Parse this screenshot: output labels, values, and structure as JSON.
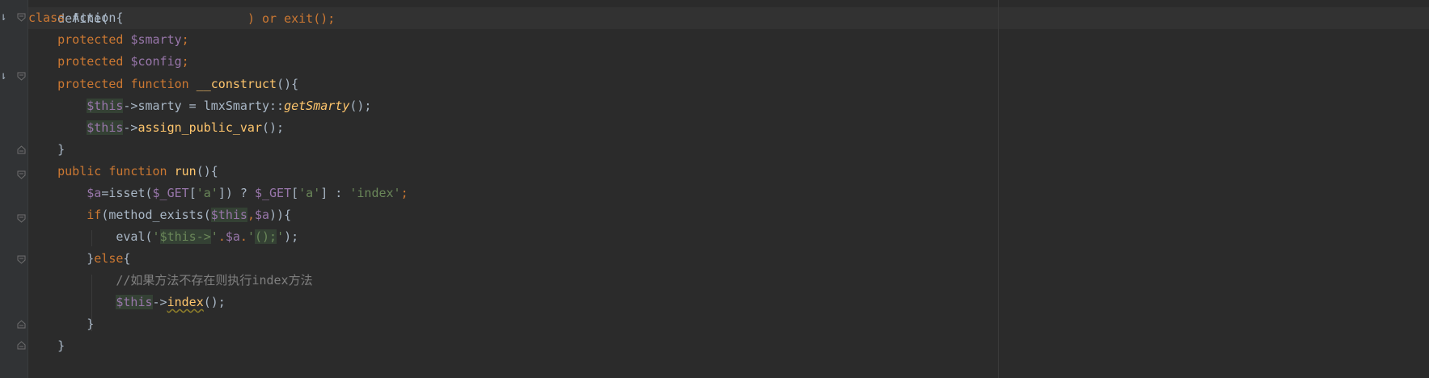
{
  "editor": {
    "top_partial": "define(",
    "top_partial_tail": ") or exit();",
    "lines": [
      {
        "kw": "class",
        "name": "Action",
        "brace": "{"
      },
      {
        "kw": "protected",
        "var": "$smarty",
        "end": ";"
      },
      {
        "kw": "protected",
        "var": "$config",
        "end": ";"
      },
      {
        "kw1": "protected",
        "kw2": "function",
        "fn": "__construct",
        "rest": "(){"
      },
      {
        "this": "$this",
        "arrow": "->smarty = lmxSmarty::",
        "fn": "getSmarty",
        "rest": "();"
      },
      {
        "this": "$this",
        "arrow": "->",
        "fn": "assign_public_var",
        "rest": "();"
      },
      {
        "text": "}"
      },
      {
        "kw1": "public",
        "kw2": "function",
        "fn": "run",
        "rest": "(){"
      },
      {
        "var": "$a",
        "p1": "=isset(",
        "get1": "$_GET",
        "p2": "[",
        "s1": "'a'",
        "p3": "]) ? ",
        "get2": "$_GET",
        "p4": "[",
        "s2": "'a'",
        "p5": "] : ",
        "s3": "'index'",
        "end": ";"
      },
      {
        "kw": "if",
        "p1": "(method_exists(",
        "this": "$this",
        "comma": ",",
        "var": "$a",
        "p2": ")){"
      },
      {
        "fn": "eval(",
        "s1": "'",
        "thisstr": "$this->",
        "s2": "'",
        "dot1": ".",
        "var": "$a",
        "dot2": ".",
        "s3": "'",
        "s4": "();",
        "s5": "'",
        "end": ");"
      },
      {
        "brace": "}",
        "kw": "else",
        "rest": "{"
      },
      {
        "comment": "//如果方法不存在则执行index方法"
      },
      {
        "this": "$this",
        "arrow": "->",
        "fn": "index",
        "rest": "();"
      },
      {
        "text": "}"
      },
      {
        "text": "}"
      }
    ]
  },
  "colors": {
    "background": "#2b2b2b",
    "keyword": "#cc7832",
    "variable": "#9876aa",
    "function": "#ffc66d",
    "string": "#6a8759",
    "comment": "#808080",
    "text": "#a9b7c6"
  }
}
